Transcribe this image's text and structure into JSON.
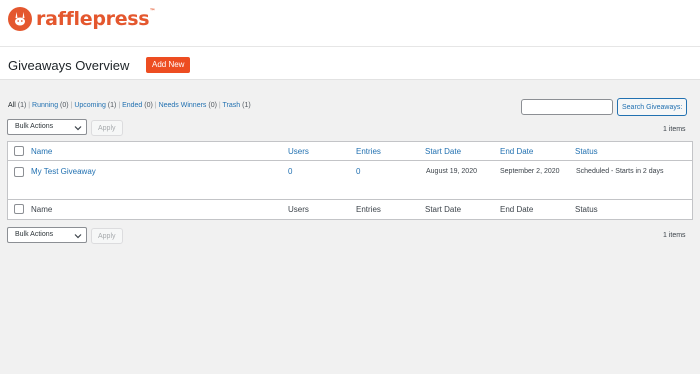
{
  "brand": {
    "name": "rafflepress",
    "tm": "™",
    "color": "#e4572e",
    "icon": "rabbit-logo-icon"
  },
  "header": {
    "title": "Giveaways Overview",
    "add_new_label": "Add New",
    "add_new_color": "#ed4d21"
  },
  "filters": [
    {
      "label": "All",
      "count": "(1)",
      "current": true
    },
    {
      "label": "Running",
      "count": "(0)"
    },
    {
      "label": "Upcoming",
      "count": "(1)"
    },
    {
      "label": "Ended",
      "count": "(0)"
    },
    {
      "label": "Needs Winners",
      "count": "(0)"
    },
    {
      "label": "Trash",
      "count": "(1)"
    }
  ],
  "search": {
    "button_label": "Search Giveaways:",
    "value": ""
  },
  "bulk_top": {
    "selected": "Bulk Actions",
    "apply_label": "Apply",
    "items_count": "1 items"
  },
  "bulk_bottom": {
    "selected": "Bulk Actions",
    "apply_label": "Apply",
    "items_count": "1 items"
  },
  "table": {
    "columns": [
      "Name",
      "Users",
      "Entries",
      "Start Date",
      "End Date",
      "Status"
    ],
    "rows": [
      {
        "name": "My Test Giveaway",
        "users": "0",
        "entries": "0",
        "start_date": "August 19, 2020",
        "end_date": "September 2, 2020",
        "status": "Scheduled - Starts in 2 days"
      }
    ],
    "footer_columns": [
      "Name",
      "Users",
      "Entries",
      "Start Date",
      "End Date",
      "Status"
    ]
  }
}
